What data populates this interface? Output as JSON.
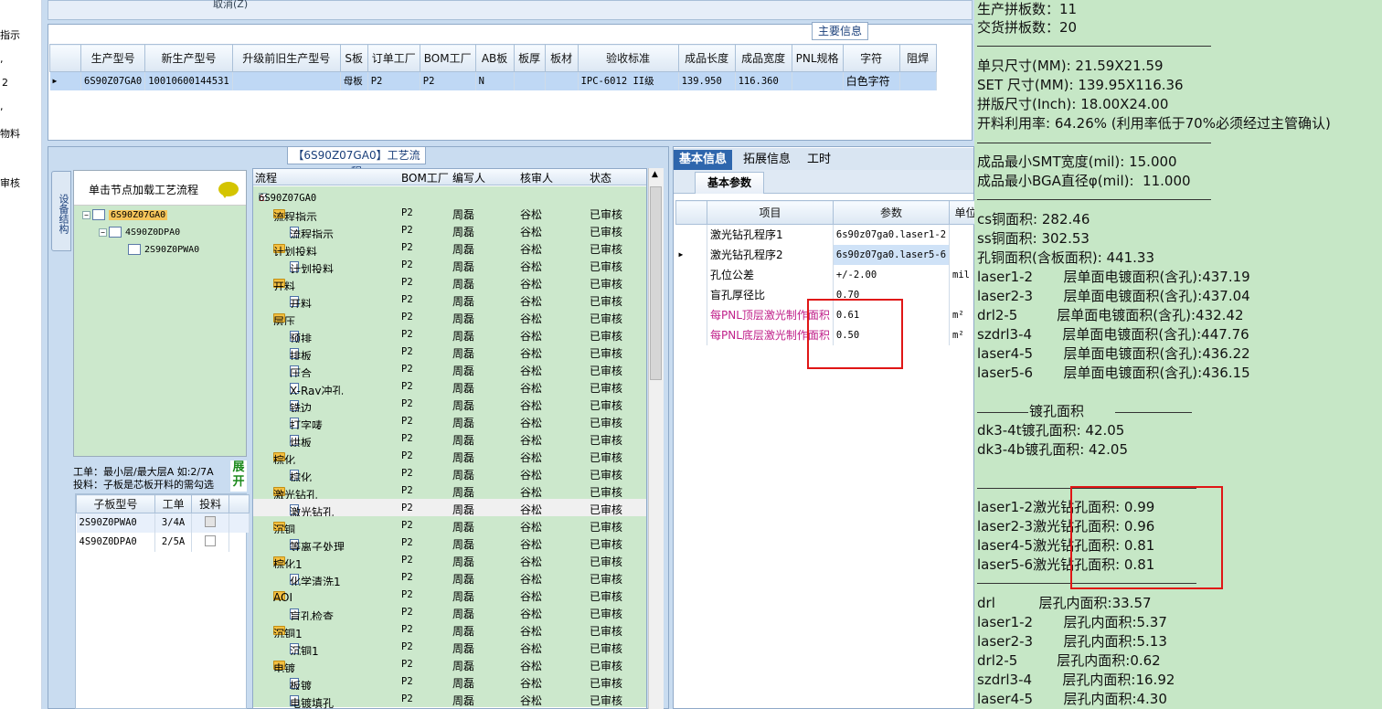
{
  "left_nav": {
    "items": [
      "指示",
      ",",
      "2",
      ",",
      "物料",
      "审核"
    ]
  },
  "top_panel": {
    "partial_label": "取消(Z)"
  },
  "main_info": {
    "title": "主要信息",
    "columns": [
      "生产型号",
      "新生产型号",
      "升级前旧生产型号",
      "S板",
      "订单工厂",
      "BOM工厂",
      "AB板",
      "板厚",
      "板材",
      "验收标准",
      "成品长度",
      "成品宽度",
      "PNL规格",
      "字符",
      "阻焊"
    ],
    "row": [
      "6S90Z07GA0",
      "10010600144531",
      "",
      "母板",
      "P2",
      "P2",
      "N",
      "",
      "",
      "IPC-6012 II级",
      "139.950",
      "116.360",
      "",
      "白色字符",
      ""
    ]
  },
  "process": {
    "title": "【6S90Z07GA0】工艺流程",
    "side_tab": "设备结构",
    "tree_hint": "单击节点加载工艺流程",
    "tree_nodes": [
      "6S90Z07GA0",
      "4S90Z0DPA0",
      "2S90Z0PWA0"
    ],
    "hint_line1": "工单：最小层/最大层A 如:2/7A",
    "hint_line2": "投料：子板是芯板开料的需勾选",
    "expand_label": "展开",
    "sub_columns": [
      "子板型号",
      "工单",
      "投料"
    ],
    "sub_rows": [
      {
        "model": "2S90Z0PWA0",
        "order": "3/4A",
        "checked": true
      },
      {
        "model": "4S90Z0DPA0",
        "order": "2/5A",
        "checked": false
      }
    ],
    "flow_columns": [
      "流程",
      "BOM工厂",
      "编写人",
      "核审人",
      "状态"
    ],
    "flow_root": "6S90Z07GA0",
    "flow_rows": [
      {
        "name": "流程指示",
        "level": 1,
        "factory": "P2",
        "writer": "周磊",
        "reviewer": "谷松",
        "status": "已审核"
      },
      {
        "name": "流程指示",
        "level": 2,
        "factory": "P2",
        "writer": "周磊",
        "reviewer": "谷松",
        "status": "已审核"
      },
      {
        "name": "计划投料",
        "level": 1,
        "factory": "P2",
        "writer": "周磊",
        "reviewer": "谷松",
        "status": "已审核"
      },
      {
        "name": "计划投料",
        "level": 2,
        "factory": "P2",
        "writer": "周磊",
        "reviewer": "谷松",
        "status": "已审核"
      },
      {
        "name": "开料",
        "level": 1,
        "factory": "P2",
        "writer": "周磊",
        "reviewer": "谷松",
        "status": "已审核"
      },
      {
        "name": "开料",
        "level": 2,
        "factory": "P2",
        "writer": "周磊",
        "reviewer": "谷松",
        "status": "已审核"
      },
      {
        "name": "层压",
        "level": 1,
        "factory": "P2",
        "writer": "周磊",
        "reviewer": "谷松",
        "status": "已审核"
      },
      {
        "name": "预排",
        "level": 2,
        "factory": "P2",
        "writer": "周磊",
        "reviewer": "谷松",
        "status": "已审核"
      },
      {
        "name": "排板",
        "level": 2,
        "factory": "P2",
        "writer": "周磊",
        "reviewer": "谷松",
        "status": "已审核"
      },
      {
        "name": "压合",
        "level": 2,
        "factory": "P2",
        "writer": "周磊",
        "reviewer": "谷松",
        "status": "已审核"
      },
      {
        "name": "X-Ray冲孔",
        "level": 2,
        "factory": "P2",
        "writer": "周磊",
        "reviewer": "谷松",
        "status": "已审核"
      },
      {
        "name": "铣边",
        "level": 2,
        "factory": "P2",
        "writer": "周磊",
        "reviewer": "谷松",
        "status": "已审核"
      },
      {
        "name": "打字唛",
        "level": 2,
        "factory": "P2",
        "writer": "周磊",
        "reviewer": "谷松",
        "status": "已审核"
      },
      {
        "name": "烘板",
        "level": 2,
        "factory": "P2",
        "writer": "周磊",
        "reviewer": "谷松",
        "status": "已审核"
      },
      {
        "name": "棕化",
        "level": 1,
        "factory": "P2",
        "writer": "周磊",
        "reviewer": "谷松",
        "status": "已审核"
      },
      {
        "name": "棕化",
        "level": 2,
        "factory": "P2",
        "writer": "周磊",
        "reviewer": "谷松",
        "status": "已审核"
      },
      {
        "name": "激光钻孔",
        "level": 1,
        "factory": "P2",
        "writer": "周磊",
        "reviewer": "谷松",
        "status": "已审核"
      },
      {
        "name": "激光钻孔",
        "level": 2,
        "factory": "P2",
        "writer": "周磊",
        "reviewer": "谷松",
        "status": "已审核",
        "selected": true
      },
      {
        "name": "沉铜",
        "level": 1,
        "factory": "P2",
        "writer": "周磊",
        "reviewer": "谷松",
        "status": "已审核"
      },
      {
        "name": "等离子处理",
        "level": 2,
        "factory": "P2",
        "writer": "周磊",
        "reviewer": "谷松",
        "status": "已审核"
      },
      {
        "name": "棕化1",
        "level": 1,
        "factory": "P2",
        "writer": "周磊",
        "reviewer": "谷松",
        "status": "已审核"
      },
      {
        "name": "化学清洗1",
        "level": 2,
        "factory": "P2",
        "writer": "周磊",
        "reviewer": "谷松",
        "status": "已审核"
      },
      {
        "name": "AOI",
        "level": 1,
        "factory": "P2",
        "writer": "周磊",
        "reviewer": "谷松",
        "status": "已审核"
      },
      {
        "name": "盲孔检查",
        "level": 2,
        "factory": "P2",
        "writer": "周磊",
        "reviewer": "谷松",
        "status": "已审核"
      },
      {
        "name": "沉铜1",
        "level": 1,
        "factory": "P2",
        "writer": "周磊",
        "reviewer": "谷松",
        "status": "已审核"
      },
      {
        "name": "沉铜1",
        "level": 2,
        "factory": "P2",
        "writer": "周磊",
        "reviewer": "谷松",
        "status": "已审核"
      },
      {
        "name": "电镀",
        "level": 1,
        "factory": "P2",
        "writer": "周磊",
        "reviewer": "谷松",
        "status": "已审核"
      },
      {
        "name": "板镀",
        "level": 2,
        "factory": "P2",
        "writer": "周磊",
        "reviewer": "谷松",
        "status": "已审核"
      },
      {
        "name": "电镀填孔",
        "level": 2,
        "factory": "P2",
        "writer": "周磊",
        "reviewer": "谷松",
        "status": "已审核"
      }
    ]
  },
  "basic_info": {
    "tabs": [
      "基本信息",
      "拓展信息",
      "工时"
    ],
    "subtab": "基本参数",
    "columns": [
      "项目",
      "参数",
      "单位"
    ],
    "rows": [
      {
        "name": "激光钻孔程序1",
        "value": "6s90z07ga0.laser1-2",
        "unit": ""
      },
      {
        "name": "激光钻孔程序2",
        "value": "6s90z07ga0.laser5-6",
        "unit": ""
      },
      {
        "name": "孔位公差",
        "value": "+/-2.00",
        "unit": "mil"
      },
      {
        "name": "盲孔厚径比",
        "value": "0.70",
        "unit": ""
      },
      {
        "name": "每PNL顶层激光制作面积",
        "value": "0.61",
        "unit": "m²"
      },
      {
        "name": "每PNL底层激光制作面积",
        "value": "0.50",
        "unit": "m²"
      }
    ]
  },
  "right_panel": {
    "lines": [
      "生产拼板数：11",
      "交货拼板数：20",
      "单只尺寸(MM): 21.59X21.59",
      "SET 尺寸(MM): 139.95X116.36",
      "拼版尺寸(Inch): 18.00X24.00",
      "开料利用率: 64.26% (利用率低于70%必须经过主管确认)",
      "成品最小SMT宽度(mil): 15.000",
      "成品最小BGA直径φ(mil):  11.000",
      "cs铜面积: 282.46",
      "ss铜面积: 302.53",
      "孔铜面积(含板面积): 441.33",
      "laser1-2       层单面电镀面积(含孔):437.19",
      "laser2-3       层单面电镀面积(含孔):437.04",
      "drl2-5         层单面电镀面积(含孔):432.42",
      "szdrl3-4       层单面电镀面积(含孔):447.76",
      "laser4-5       层单面电镀面积(含孔):436.22",
      "laser5-6       层单面电镀面积(含孔):436.15",
      "镀孔面积",
      "dk3-4t镀孔面积: 42.05",
      "dk3-4b镀孔面积: 42.05",
      "laser1-2激光钻孔面积: 0.99",
      "laser2-3激光钻孔面积: 0.96",
      "laser4-5激光钻孔面积: 0.81",
      "laser5-6激光钻孔面积: 0.81",
      "drl          层孔内面积:33.57",
      "laser1-2       层孔内面积:5.37",
      "laser2-3       层孔内面积:5.13",
      "drl2-5         层孔内面积:0.62",
      "szdrl3-4       层孔内面积:16.92",
      "laser4-5       层孔内面积:4.30"
    ]
  },
  "colors": {
    "highlight_box": "#e01616",
    "green_panel": "#c6e7c6",
    "tab_active": "#2e66ad"
  }
}
